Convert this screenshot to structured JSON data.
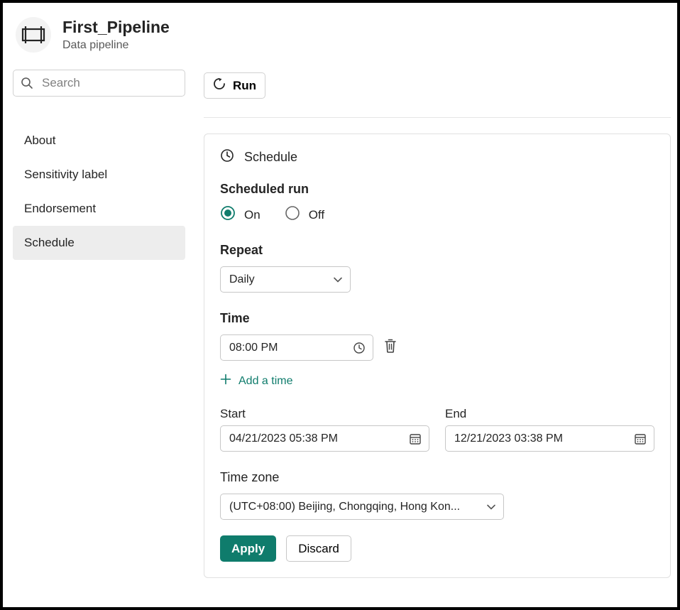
{
  "header": {
    "title": "First_Pipeline",
    "subtitle": "Data pipeline"
  },
  "sidebar": {
    "search_placeholder": "Search",
    "items": [
      "About",
      "Sensitivity label",
      "Endorsement",
      "Schedule"
    ],
    "selected_index": 3
  },
  "run_button": {
    "label": "Run"
  },
  "panel": {
    "title": "Schedule",
    "scheduled_run": {
      "label": "Scheduled run",
      "options": {
        "on": "On",
        "off": "Off"
      },
      "value": "on"
    },
    "repeat": {
      "label": "Repeat",
      "value": "Daily"
    },
    "time": {
      "label": "Time",
      "items": [
        "08:00 PM"
      ],
      "add_label": "Add a time"
    },
    "date_range": {
      "start": {
        "label": "Start",
        "value": "04/21/2023 05:38 PM"
      },
      "end": {
        "label": "End",
        "value": "12/21/2023 03:38 PM"
      }
    },
    "timezone": {
      "label": "Time zone",
      "value": "(UTC+08:00) Beijing, Chongqing, Hong Kon..."
    },
    "actions": {
      "apply": "Apply",
      "discard": "Discard"
    }
  },
  "colors": {
    "accent": "#0f7c6c"
  }
}
